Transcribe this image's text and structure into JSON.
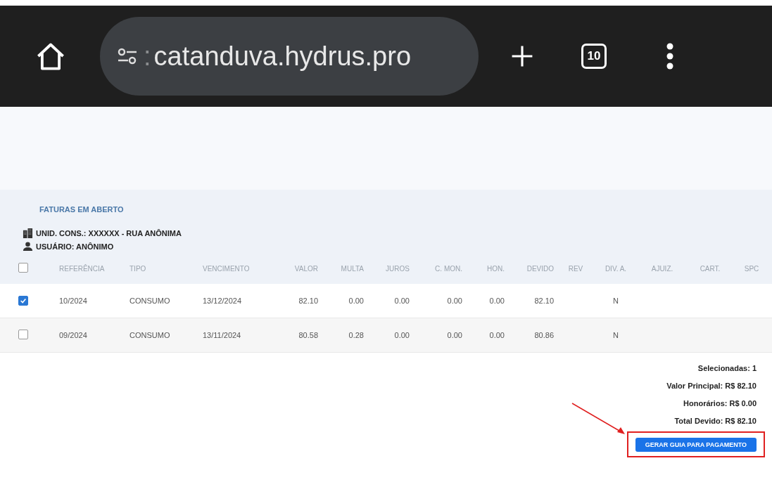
{
  "browser": {
    "url_prefix": ":",
    "url": "catanduva.hydrus.pro",
    "tab_count": "10"
  },
  "panel": {
    "title": "FATURAS EM ABERTO",
    "unit": "UNID. CONS.: XXXXXX - RUA ANÔNIMA",
    "user": "USUÁRIO: ANÔNIMO"
  },
  "table": {
    "all_checked": false,
    "columns": [
      "REFERÊNCIA",
      "TIPO",
      "VENCIMENTO",
      "VALOR",
      "MULTA",
      "JUROS",
      "C. MON.",
      "HON.",
      "DEVIDO",
      "REV",
      "DIV. A.",
      "AJUIZ.",
      "CART.",
      "SPC"
    ],
    "rows": [
      {
        "selected": true,
        "cells": [
          "10/2024",
          "CONSUMO",
          "13/12/2024",
          "82.10",
          "0.00",
          "0.00",
          "0.00",
          "0.00",
          "82.10",
          null,
          "N",
          null,
          null,
          null
        ]
      },
      {
        "selected": false,
        "cells": [
          "09/2024",
          "CONSUMO",
          "13/11/2024",
          "80.58",
          "0.28",
          "0.00",
          "0.00",
          "0.00",
          "80.86",
          null,
          "N",
          null,
          null,
          null
        ]
      }
    ]
  },
  "summary": [
    "Selecionadas: 1",
    "Valor Principal: R$ 82.10",
    "Honorários: R$ 0.00",
    "Total Devido: R$ 82.10"
  ],
  "button": "GERAR GUIA PARA PAGAMENTO"
}
